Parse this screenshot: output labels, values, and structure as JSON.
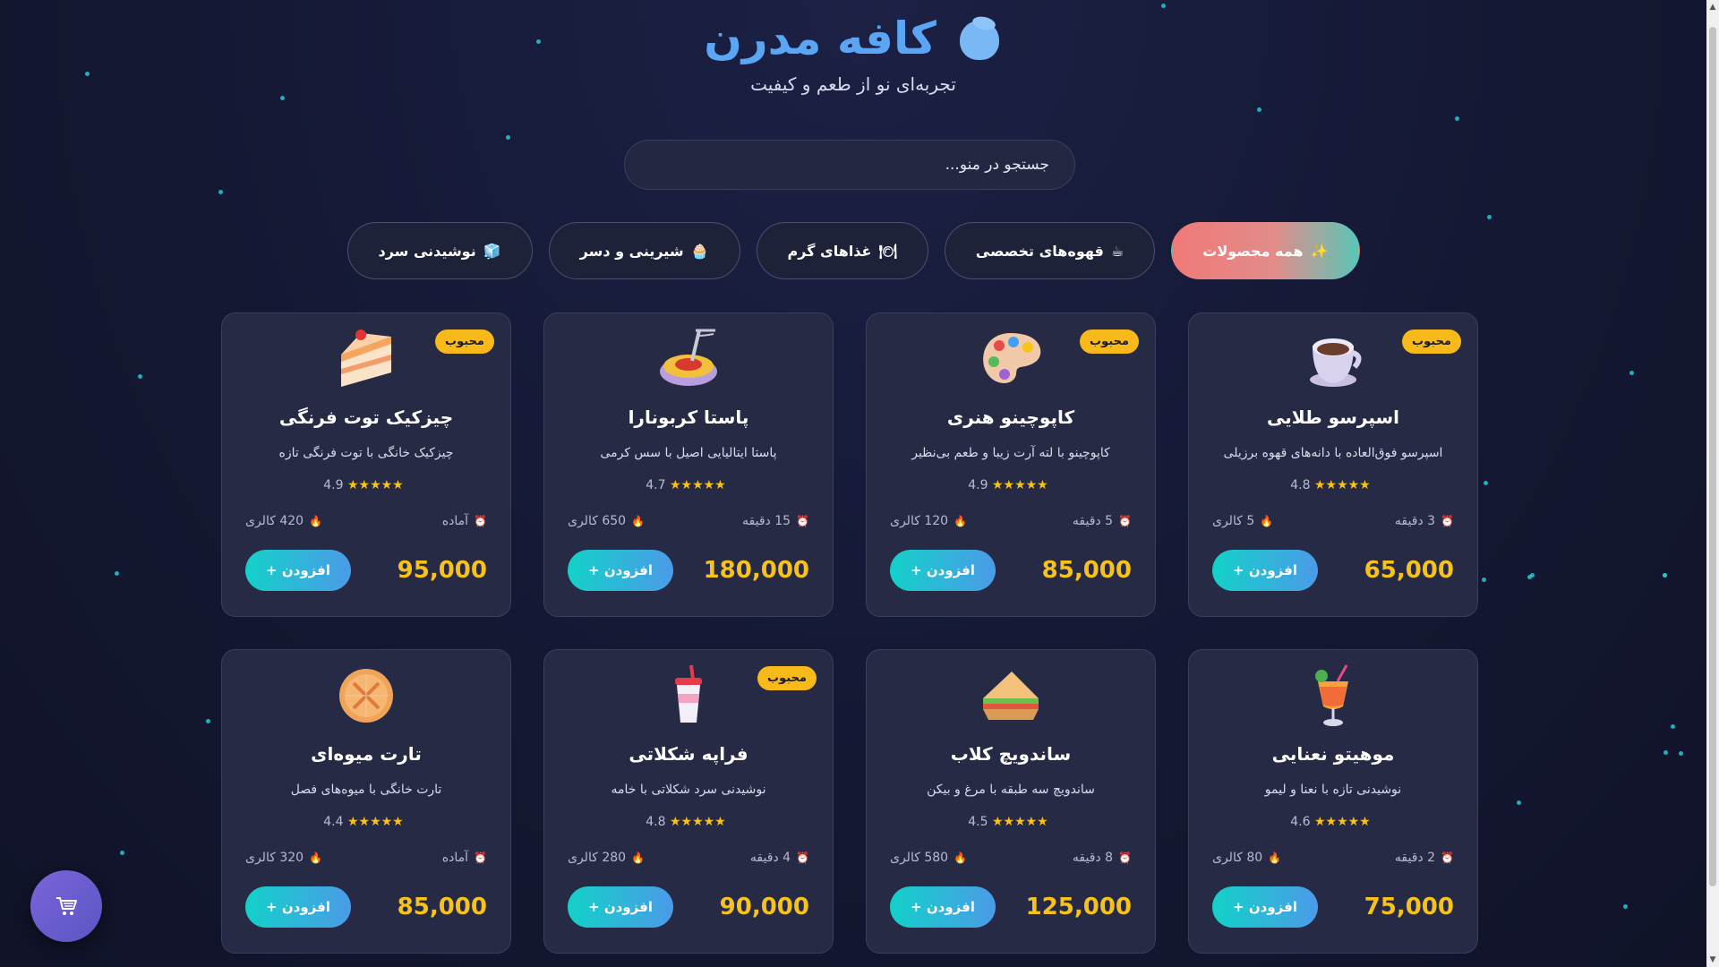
{
  "header": {
    "title": "کافه مدرن",
    "subtitle": "تجربه‌ای نو از طعم و کیفیت"
  },
  "search": {
    "placeholder": "جستجو در منو..."
  },
  "tabs": [
    {
      "label": "همه محصولات",
      "icon": "✨",
      "active": true
    },
    {
      "label": "قهوه‌های تخصصی",
      "icon": "☕",
      "active": false
    },
    {
      "label": "غذاهای گرم",
      "icon": "🍽",
      "active": false
    },
    {
      "label": "شیرینی و دسر",
      "icon": "🧁",
      "active": false
    },
    {
      "label": "نوشیدنی سرد",
      "icon": "🧊",
      "active": false
    }
  ],
  "products": [
    {
      "name": "اسپرسو طلایی",
      "desc": "اسپرسو فوق‌العاده با دانه‌های قهوه برزیلی",
      "rating": "4.8",
      "stars": "★★★★★",
      "time": "3 دقیقه",
      "calories": "5 کالری",
      "price": "65,000",
      "badge": "محبوب",
      "icon": "coffee-cup-icon",
      "add": "افزودن +"
    },
    {
      "name": "کاپوچینو هنری",
      "desc": "کاپوچینو با لته آرت زیبا و طعم بی‌نظیر",
      "rating": "4.9",
      "stars": "★★★★★",
      "time": "5 دقیقه",
      "calories": "120 کالری",
      "price": "85,000",
      "badge": "محبوب",
      "icon": "art-palette-icon",
      "add": "افزودن +"
    },
    {
      "name": "پاستا کربونارا",
      "desc": "پاستا ایتالیایی اصیل با سس کرمی",
      "rating": "4.7",
      "stars": "★★★★★",
      "time": "15 دقیقه",
      "calories": "650 کالری",
      "price": "180,000",
      "badge": "",
      "icon": "spaghetti-icon",
      "add": "افزودن +"
    },
    {
      "name": "چیزکیک توت فرنگی",
      "desc": "چیزکیک خانگی با توت فرنگی تازه",
      "rating": "4.9",
      "stars": "★★★★★",
      "time": "آماده",
      "calories": "420 کالری",
      "price": "95,000",
      "badge": "محبوب",
      "icon": "cake-slice-icon",
      "add": "افزودن +"
    },
    {
      "name": "موهیتو نعنایی",
      "desc": "نوشیدنی تازه با نعنا و لیمو",
      "rating": "4.6",
      "stars": "★★★★★",
      "time": "2 دقیقه",
      "calories": "80 کالری",
      "price": "75,000",
      "badge": "",
      "icon": "cocktail-icon",
      "add": "افزودن +"
    },
    {
      "name": "ساندویچ کلاب",
      "desc": "ساندویچ سه طبقه با مرغ و بیکن",
      "rating": "4.5",
      "stars": "★★★★★",
      "time": "8 دقیقه",
      "calories": "580 کالری",
      "price": "125,000",
      "badge": "",
      "icon": "sandwich-icon",
      "add": "افزودن +"
    },
    {
      "name": "فراپه شکلاتی",
      "desc": "نوشیدنی سرد شکلاتی با خامه",
      "rating": "4.8",
      "stars": "★★★★★",
      "time": "4 دقیقه",
      "calories": "280 کالری",
      "price": "90,000",
      "badge": "محبوب",
      "icon": "cup-straw-icon",
      "add": "افزودن +"
    },
    {
      "name": "تارت میوه‌ای",
      "desc": "تارت خانگی با میوه‌های فصل",
      "rating": "4.4",
      "stars": "★★★★★",
      "time": "آماده",
      "calories": "320 کالری",
      "price": "85,000",
      "badge": "",
      "icon": "pie-icon",
      "add": "افزودن +"
    }
  ],
  "cart": {
    "icon": "shopping-cart-icon"
  },
  "colors": {
    "accent": "#5aa6f5",
    "price": "#f8c21b",
    "badge": "#f8b91b",
    "button_from": "#13d1c9",
    "button_to": "#4b9be8"
  }
}
